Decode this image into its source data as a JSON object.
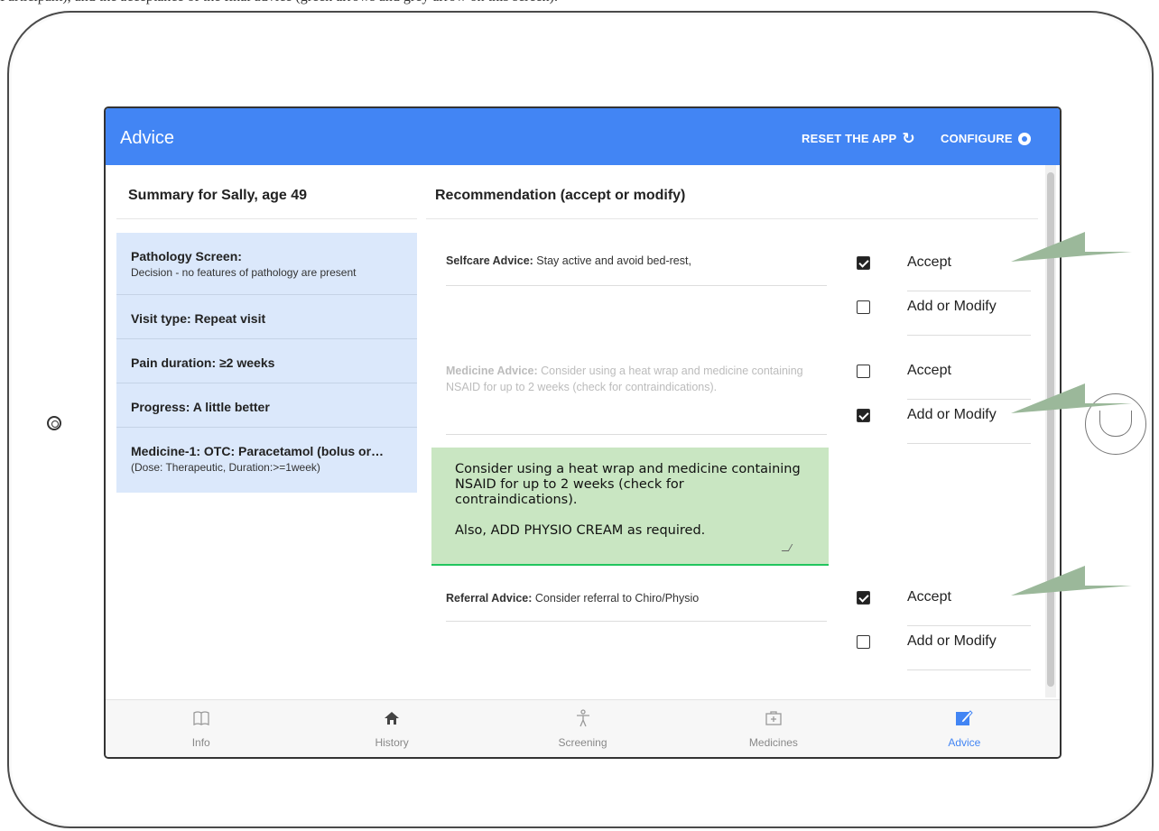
{
  "caption": "Participant), and the acceptance of the final advice (green arrows and grey arrow on this screen).",
  "app": {
    "title": "Advice",
    "reset_label": "RESET THE APP",
    "configure_label": "CONFIGURE",
    "accent": "#4285f4"
  },
  "summary": {
    "header": "Summary for Sally, age 49",
    "rows": [
      {
        "title": "Pathology Screen:",
        "sub": "Decision - no features of pathology are present"
      },
      {
        "title": "Visit type: Repeat visit",
        "sub": ""
      },
      {
        "title": "Pain duration: ≥2 weeks",
        "sub": ""
      },
      {
        "title": "Progress: A little better",
        "sub": ""
      },
      {
        "title": "Medicine-1: OTC: Paracetamol (bolus or…",
        "sub": "(Dose: Therapeutic, Duration:>=1week)"
      }
    ]
  },
  "recommendation": {
    "header": "Recommendation (accept or modify)",
    "selfcare": {
      "label": "Selfcare Advice:",
      "text": "Stay active and avoid bed-rest,"
    },
    "medicine": {
      "label": "Medicine Advice:",
      "text": "Consider using a heat wrap and medicine containing NSAID for up to 2 weeks (check for contraindications)."
    },
    "edit_text_line1": "Consider using a heat wrap and medicine containing NSAID for up to 2 weeks (check for contraindications).",
    "edit_text_line2": "Also, ADD PHYSIO CREAM as required.",
    "referral": {
      "label": "Referral Advice:",
      "text": "Consider referral to Chiro/Physio"
    }
  },
  "options": [
    {
      "label": "Accept",
      "checked": true
    },
    {
      "label": "Add or Modify",
      "checked": false
    },
    {
      "label": "Accept",
      "checked": false
    },
    {
      "label": "Add or Modify",
      "checked": true
    },
    {
      "label": "Accept",
      "checked": true
    },
    {
      "label": "Add or Modify",
      "checked": false
    }
  ],
  "nav": {
    "items": [
      {
        "label": "Info",
        "icon": "book-icon"
      },
      {
        "label": "History",
        "icon": "home-icon"
      },
      {
        "label": "Screening",
        "icon": "body-icon"
      },
      {
        "label": "Medicines",
        "icon": "medicine-box-icon"
      },
      {
        "label": "Advice",
        "icon": "edit-icon"
      }
    ],
    "active": "Advice"
  },
  "annotation_color": "#9bb89a"
}
